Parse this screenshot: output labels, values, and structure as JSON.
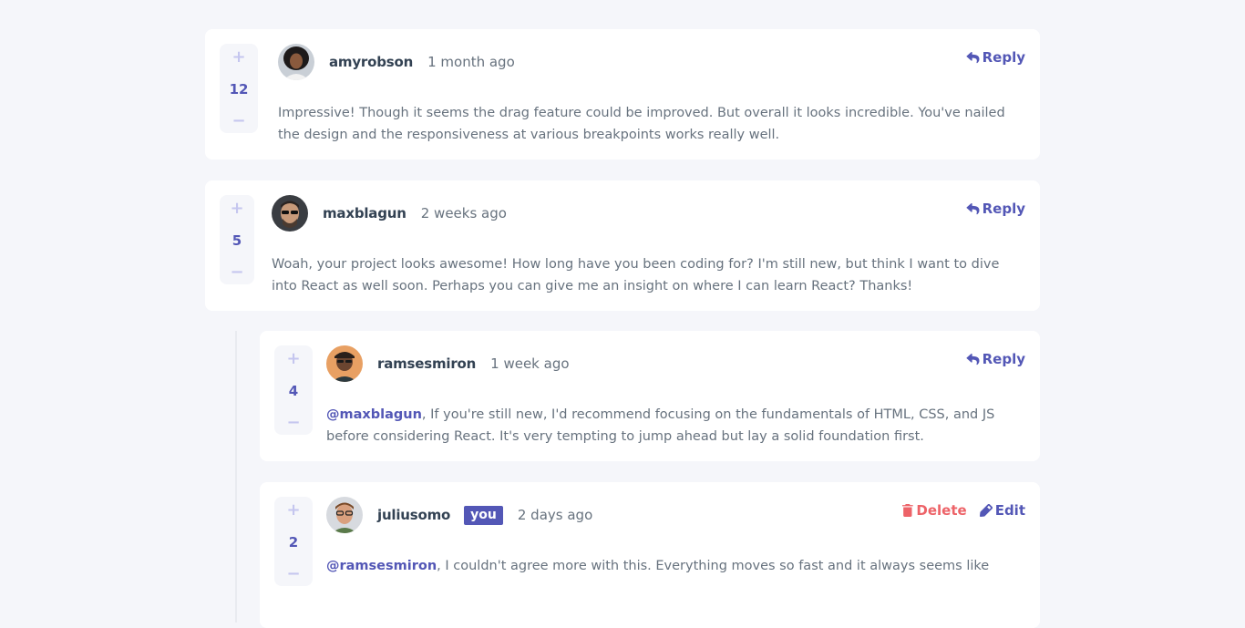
{
  "comments": [
    {
      "score": "12",
      "username": "amyrobson",
      "time": "1 month ago",
      "reply_label": "Reply",
      "content": "Impressive! Though it seems the drag feature could be improved. But overall it looks incredible. You've nailed the design and the responsiveness at various breakpoints works really well."
    },
    {
      "score": "5",
      "username": "maxblagun",
      "time": "2 weeks ago",
      "reply_label": "Reply",
      "content": "Woah, your project looks awesome! How long have you been coding for? I'm still new, but think I want to dive into React as well soon. Perhaps you can give me an insight on where I can learn React? Thanks!"
    }
  ],
  "replies": [
    {
      "score": "4",
      "username": "ramsesmiron",
      "time": "1 week ago",
      "reply_label": "Reply",
      "mention": "@maxblagun",
      "content": ", If you're still new, I'd recommend focusing on the fundamentals of HTML, CSS, and JS before considering React. It's very tempting to jump ahead but lay a solid foundation first."
    },
    {
      "score": "2",
      "username": "juliusomo",
      "you_label": "you",
      "time": "2 days ago",
      "delete_label": "Delete",
      "edit_label": "Edit",
      "mention": "@ramsesmiron",
      "content": ", I couldn't agree more with this. Everything moves so fast and it always seems like"
    }
  ],
  "vote": {
    "plus": "+",
    "minus": "−"
  },
  "icons": {
    "upvote": "plus-icon",
    "downvote": "minus-icon",
    "reply": "reply-arrow-icon",
    "delete": "trash-icon",
    "edit": "pencil-icon"
  },
  "colors": {
    "page_bg": "#f5f6fa",
    "card_bg": "#ffffff",
    "primary": "#5357b6",
    "primary_light": "#c5c6ef",
    "danger": "#ed6368",
    "heading": "#334253",
    "body_text": "#67727e"
  }
}
